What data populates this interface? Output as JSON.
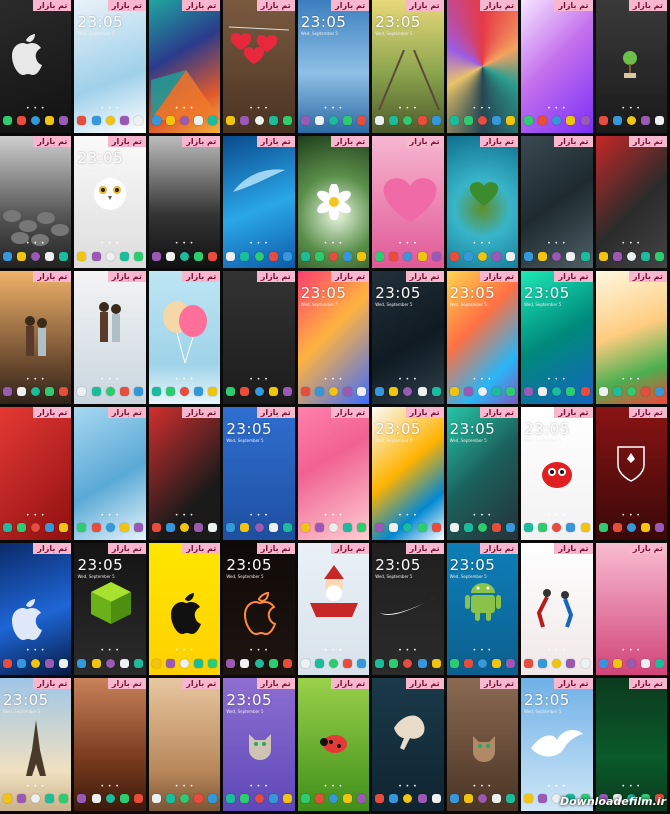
{
  "gallery": {
    "tag_label": "تم بازار",
    "clock_text": "23:05",
    "date_text": "Wed, September 5",
    "page_dots": "• • •",
    "watermark": "Downloadefilm.ir",
    "tiles": [
      {
        "bg": "linear-gradient(160deg,#2b2b2b,#111)",
        "motif": "apple-logo",
        "show_clock": false
      },
      {
        "bg": "linear-gradient(160deg,#e9f2f8,#9fd0ea 60%,#fff)",
        "motif": "none",
        "show_clock": true
      },
      {
        "bg": "linear-gradient(150deg,#1fa6a0,#2a3b8c 40%,#e05a2c 75%,#f3b23a)",
        "motif": "poly",
        "show_clock": false
      },
      {
        "bg": "linear-gradient(180deg,#7a5a3f,#4a3322)",
        "motif": "hearts",
        "show_clock": false
      },
      {
        "bg": "linear-gradient(180deg,#3b7fbf,#8ec0e6 55%,#2c6aa4)",
        "motif": "none",
        "show_clock": true
      },
      {
        "bg": "linear-gradient(180deg,#e8d97a,#8ba44d 55%,#4e5b2b)",
        "motif": "rails",
        "show_clock": true
      },
      {
        "bg": "conic-gradient(#e63946,#f4a261,#2a9d8f,#264653,#e9c46a,#9b5de5,#e63946)",
        "motif": "none",
        "show_clock": false
      },
      {
        "bg": "linear-gradient(135deg,#f6e6ff,#c471ed 45%,#7b2ff7)",
        "motif": "none",
        "show_clock": false
      },
      {
        "bg": "linear-gradient(180deg,#3a3a3a,#1a1a1a)",
        "motif": "tree",
        "show_clock": false
      },
      {
        "bg": "linear-gradient(180deg,#cfcfcf,#555 60%,#222)",
        "motif": "stones",
        "show_clock": false
      },
      {
        "bg": "linear-gradient(180deg,#fafafa,#ddd)",
        "motif": "owl",
        "show_clock": true
      },
      {
        "bg": "linear-gradient(180deg,#bdbdbd,#333 60%,#111)",
        "motif": "none",
        "show_clock": false
      },
      {
        "bg": "linear-gradient(160deg,#0a4a8c,#2aa7e8 55%,#0d5aa8)",
        "motif": "feather",
        "show_clock": false
      },
      {
        "bg": "radial-gradient(circle at 55% 60%,#e8f5e0,#5a8f4a 45%,#1f3d1c)",
        "motif": "flower",
        "show_clock": false
      },
      {
        "bg": "linear-gradient(180deg,#f7b7d0,#e05897)",
        "motif": "heart-fur",
        "show_clock": false
      },
      {
        "bg": "radial-gradient(circle at 50% 55%,#5f8f2a,#38b5c9 35%,#0f6e8c)",
        "motif": "island",
        "show_clock": false
      },
      {
        "bg": "linear-gradient(145deg,#3a4a52,#1e2a30 50%,#4e6066)",
        "motif": "none",
        "show_clock": false
      },
      {
        "bg": "linear-gradient(135deg,#c62828,#2b2b2b 55%,#444)",
        "motif": "none",
        "show_clock": false
      },
      {
        "bg": "linear-gradient(180deg,#f0b36a,#6b4a2f 70%,#2f2418)",
        "motif": "couple",
        "show_clock": false
      },
      {
        "bg": "linear-gradient(180deg,#f4f4f4,#c9d6e0)",
        "motif": "kiss",
        "show_clock": false
      },
      {
        "bg": "linear-gradient(180deg,#bde6f4,#9fd3e8 70%,#e8f6fb)",
        "motif": "balloons",
        "show_clock": false
      },
      {
        "bg": "linear-gradient(180deg,#333,#1b1b1b)",
        "motif": "none",
        "show_clock": false
      },
      {
        "bg": "linear-gradient(135deg,#ff3d6e,#ffb340 45%,#3d6cff)",
        "motif": "none",
        "show_clock": true
      },
      {
        "bg": "linear-gradient(150deg,#23303a,#0f1a22 55%,#2e3f4a)",
        "motif": "none",
        "show_clock": true
      },
      {
        "bg": "linear-gradient(135deg,#ffd54f,#ff7043 40%,#29b6f6 75%,#7e57c2)",
        "motif": "none",
        "show_clock": true
      },
      {
        "bg": "linear-gradient(150deg,#1de9b6,#00897b 50%,#1565c0)",
        "motif": "none",
        "show_clock": true
      },
      {
        "bg": "linear-gradient(160deg,#fff8e1,#ffcc80 45%,#4caf50 75%,#f44336)",
        "motif": "none",
        "show_clock": false
      },
      {
        "bg": "linear-gradient(135deg,#e53935,#8e1010)",
        "motif": "none",
        "show_clock": false
      },
      {
        "bg": "linear-gradient(150deg,#a8d8f0,#5aa9d6 55%,#e6f4fb)",
        "motif": "none",
        "show_clock": false
      },
      {
        "bg": "linear-gradient(135deg,#d32f2f,#1a1a1a 70%)",
        "motif": "none",
        "show_clock": false
      },
      {
        "bg": "linear-gradient(180deg,#2f6fd0,#1e4fa0)",
        "motif": "none",
        "show_clock": true
      },
      {
        "bg": "linear-gradient(150deg,#ff80ab,#f06292 40%,#ffcdd2)",
        "motif": "none",
        "show_clock": false
      },
      {
        "bg": "linear-gradient(140deg,#fafafa,#ffb300 45%,#0288d1 75%,#ffffff)",
        "motif": "none",
        "show_clock": true
      },
      {
        "bg": "linear-gradient(135deg,#26c6a8,#1b5e5a 50%,#263238)",
        "motif": "none",
        "show_clock": true
      },
      {
        "bg": "linear-gradient(180deg,#ffffff,#f2f2f2)",
        "motif": "red-monster",
        "show_clock": true
      },
      {
        "bg": "linear-gradient(180deg,#8a1414,#3a0808)",
        "motif": "crest",
        "show_clock": false
      },
      {
        "bg": "linear-gradient(160deg,#0b2a6b,#1e66d6 55%,#061a44)",
        "motif": "apple-glass",
        "show_clock": false
      },
      {
        "bg": "linear-gradient(180deg,#141414,#2b2b2b)",
        "motif": "cube",
        "show_clock": true
      },
      {
        "bg": "linear-gradient(180deg,#ffe600,#ffd000)",
        "motif": "apple-splat",
        "show_clock": false
      },
      {
        "bg": "linear-gradient(180deg,#0f0a08,#1e1410)",
        "motif": "apple-glow",
        "show_clock": true
      },
      {
        "bg": "linear-gradient(180deg,#e9f1f7,#d8e2ea)",
        "motif": "santa",
        "show_clock": false
      },
      {
        "bg": "linear-gradient(180deg,#1f1f1f,#2b2b2b)",
        "motif": "swoosh",
        "show_clock": true
      },
      {
        "bg": "linear-gradient(180deg,#0e7fb8,#0b5f8e)",
        "motif": "android",
        "show_clock": true
      },
      {
        "bg": "linear-gradient(180deg,#ffffff,#f0e8e8)",
        "motif": "dancers",
        "show_clock": false
      },
      {
        "bg": "linear-gradient(180deg,#f8bcd0,#d1447a)",
        "motif": "none",
        "show_clock": false
      },
      {
        "bg": "linear-gradient(180deg,#9ec6e8,#f0e0c0 70%,#c9b28a)",
        "motif": "eiffel",
        "show_clock": true
      },
      {
        "bg": "linear-gradient(180deg,#c7825a,#7a3b1e 60%,#3b1a0c)",
        "motif": "none",
        "show_clock": false
      },
      {
        "bg": "linear-gradient(180deg,#e8c7a0,#b8875a 70%,#7a5634)",
        "motif": "none",
        "show_clock": false
      },
      {
        "bg": "linear-gradient(180deg,#8e6fd1,#5e48b8)",
        "motif": "cat",
        "show_clock": true
      },
      {
        "bg": "linear-gradient(180deg,#9ad14a,#3f8f1a)",
        "motif": "ladybug",
        "show_clock": false
      },
      {
        "bg": "linear-gradient(180deg,#1a3a4a,#0f2430)",
        "motif": "horse",
        "show_clock": false
      },
      {
        "bg": "linear-gradient(180deg,#8a6a52,#4a3424)",
        "motif": "cat2",
        "show_clock": false
      },
      {
        "bg": "linear-gradient(180deg,#6fb0e6,#cfe7f7)",
        "motif": "dove",
        "show_clock": true
      },
      {
        "bg": "linear-gradient(180deg,#0c3a1e,#0a5a2a 60%,#0c3a1e)",
        "motif": "none",
        "show_clock": false
      }
    ]
  }
}
